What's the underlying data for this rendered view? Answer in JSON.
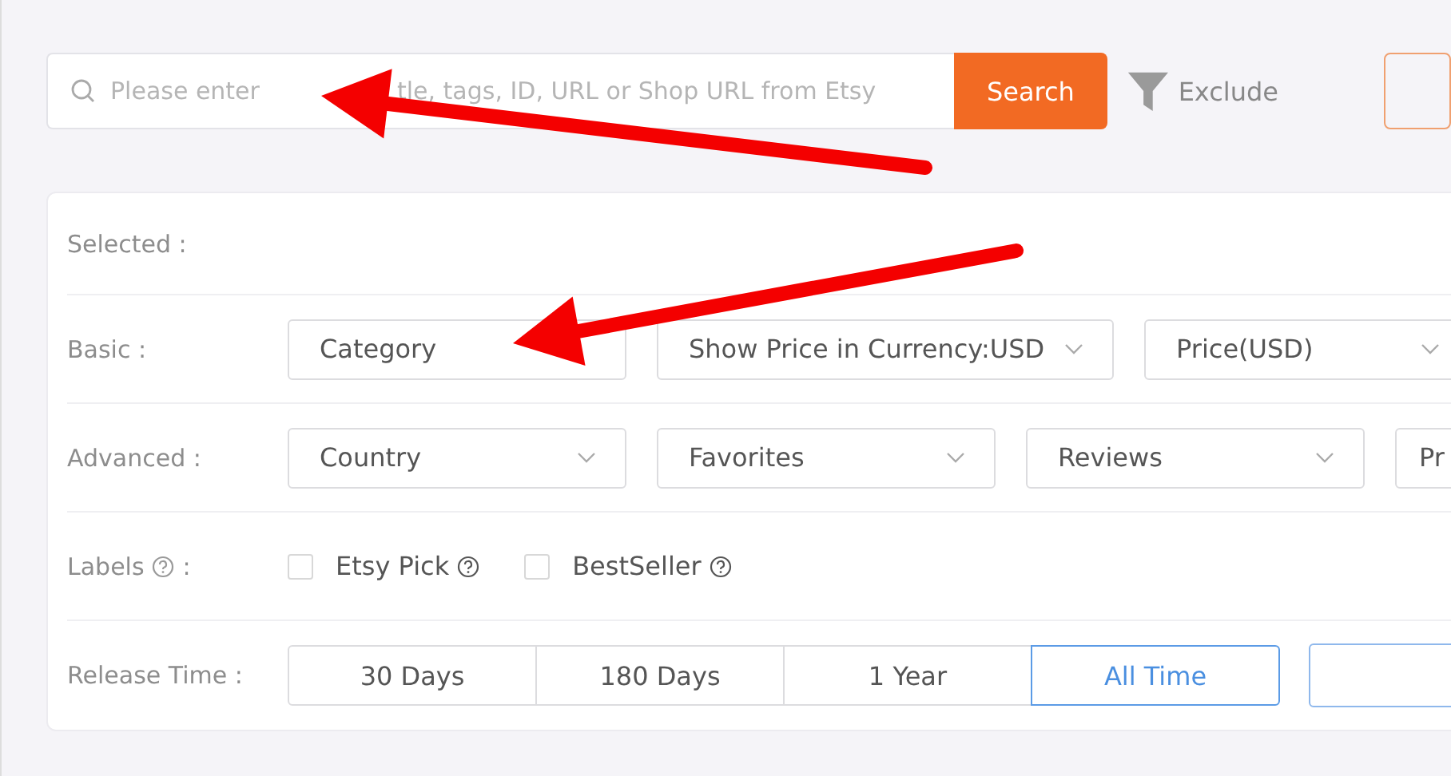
{
  "search": {
    "placeholder_parts": [
      "Please enter",
      "tle, tags, ID, URL or Shop URL from Etsy"
    ],
    "button": "Search",
    "exclude": "Exclude"
  },
  "filters": {
    "selected": {
      "label": "Selected :"
    },
    "basic": {
      "label": "Basic :",
      "dropdowns": [
        {
          "text": "Category",
          "chevron": false
        },
        {
          "text": "Show Price in Currency:USD",
          "chevron": true
        },
        {
          "text": "Price(USD)",
          "chevron": true
        }
      ]
    },
    "advanced": {
      "label": "Advanced :",
      "dropdowns": [
        {
          "text": "Country",
          "chevron": true
        },
        {
          "text": "Favorites",
          "chevron": true
        },
        {
          "text": "Reviews",
          "chevron": true
        },
        {
          "text": "Pr",
          "chevron": false
        }
      ]
    },
    "labels": {
      "label": "Labels",
      "suffix": ":",
      "options": [
        {
          "text": "Etsy Pick",
          "checked": false
        },
        {
          "text": "BestSeller",
          "checked": false
        }
      ]
    },
    "release_time": {
      "label": "Release Time :",
      "options": [
        {
          "text": "30 Days",
          "selected": false
        },
        {
          "text": "180 Days",
          "selected": false
        },
        {
          "text": "1 Year",
          "selected": false
        },
        {
          "text": "All Time",
          "selected": true
        }
      ]
    }
  },
  "annotations": [
    {
      "kind": "arrow"
    },
    {
      "kind": "arrow"
    }
  ]
}
